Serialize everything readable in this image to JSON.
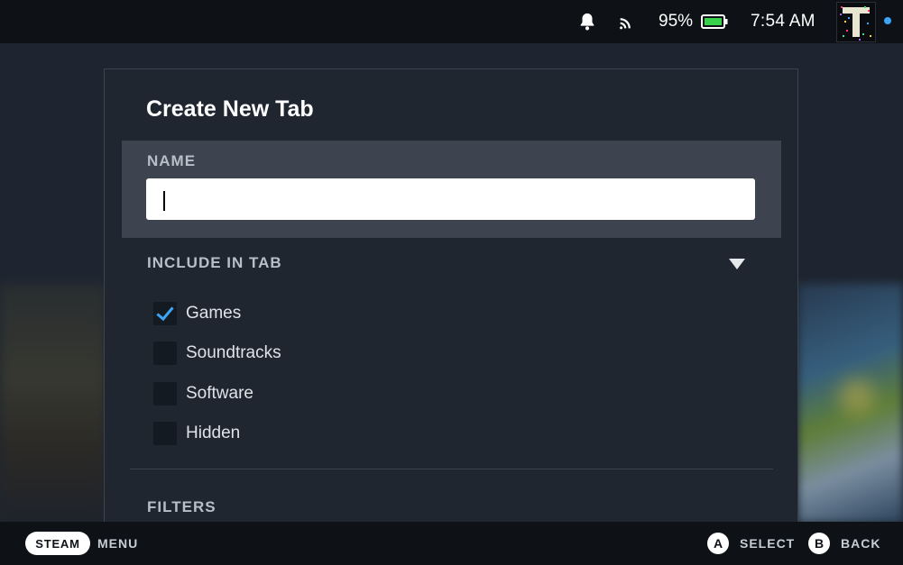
{
  "status_bar": {
    "battery_percent": "95%",
    "time": "7:54 AM",
    "icons": [
      "bell-icon",
      "cast-icon",
      "battery-icon"
    ],
    "avatar_initial": "T",
    "online_color": "#3ea4f5"
  },
  "dialog": {
    "title": "Create New Tab",
    "name_label": "NAME",
    "name_value": "",
    "include_label": "INCLUDE IN TAB",
    "options": [
      {
        "label": "Games",
        "checked": true
      },
      {
        "label": "Soundtracks",
        "checked": false
      },
      {
        "label": "Software",
        "checked": false
      },
      {
        "label": "Hidden",
        "checked": false
      }
    ],
    "filters_label": "FILTERS"
  },
  "bottom_bar": {
    "steam_label": "STEAM",
    "menu_label": "MENU",
    "a_button": "A",
    "select_label": "SELECT",
    "b_button": "B",
    "back_label": "BACK"
  },
  "colors": {
    "accent": "#3ea4f5",
    "dialog_bg": "#1f2630",
    "highlight_bg": "#3d4450"
  }
}
